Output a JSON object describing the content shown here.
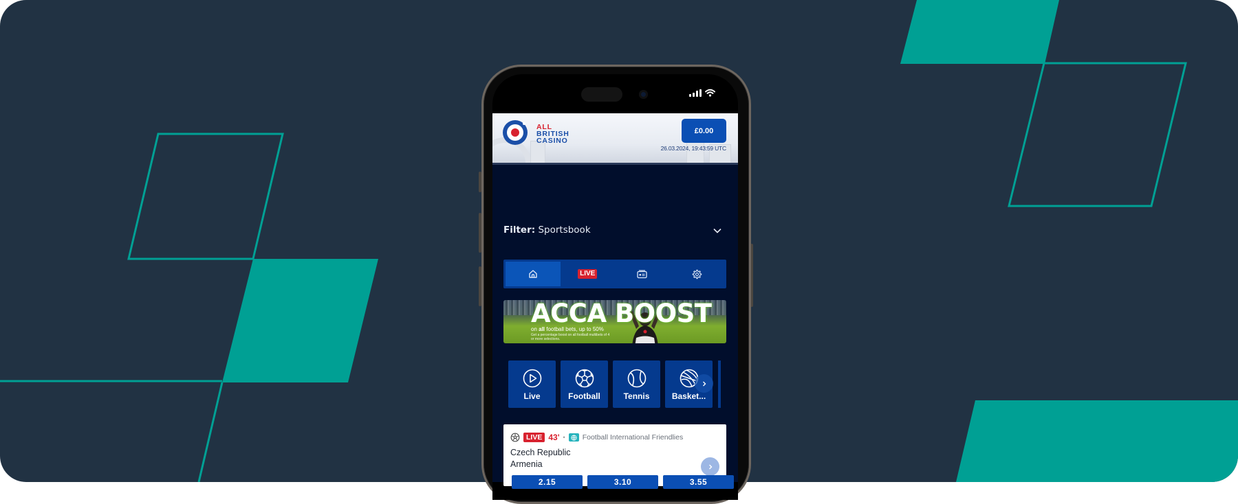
{
  "colors": {
    "background": "#213243",
    "accent_teal": "#00a094",
    "app_dark": "#010e2c",
    "app_blue": "#053a8e",
    "button_blue": "#0b4fb4",
    "live_red": "#d8222f"
  },
  "device": {
    "status_icons": [
      "cellular-signal-icon",
      "wifi-icon"
    ]
  },
  "header": {
    "logo": {
      "line1": "ALL",
      "line2": "BRITISH",
      "line3": "CASINO"
    },
    "balance": "£0.00",
    "datetime": "26.03.2024, 19:43:59 UTC"
  },
  "filter": {
    "label": "Filter:",
    "value": "Sportsbook"
  },
  "tabbar": {
    "tabs": [
      {
        "name": "home",
        "icon": "home-icon",
        "active": true
      },
      {
        "name": "live",
        "label": "LIVE"
      },
      {
        "name": "betslip",
        "icon": "ticket-icon"
      },
      {
        "name": "settings",
        "icon": "gear-icon"
      }
    ]
  },
  "promo": {
    "title": "ACCA BOOST",
    "subtitle_pre": "on ",
    "subtitle_bold": "all",
    "subtitle_post": " football bets, up to 50%",
    "fine_print": "Get a percentage boost on all football multibets of 4 or more selections."
  },
  "sports": [
    {
      "label": "Live",
      "icon": "play-icon"
    },
    {
      "label": "Football",
      "icon": "football-icon"
    },
    {
      "label": "Tennis",
      "icon": "tennis-ball-icon"
    },
    {
      "label": "Basket...",
      "icon": "basketball-icon"
    }
  ],
  "match": {
    "sport_icon": "football-icon",
    "live_label": "LIVE",
    "minute": "43'",
    "separator": "•",
    "league": "Football International Friendlies",
    "home": "Czech Republic",
    "away": "Armenia",
    "odds": [
      "2.15",
      "3.10",
      "3.55"
    ]
  }
}
